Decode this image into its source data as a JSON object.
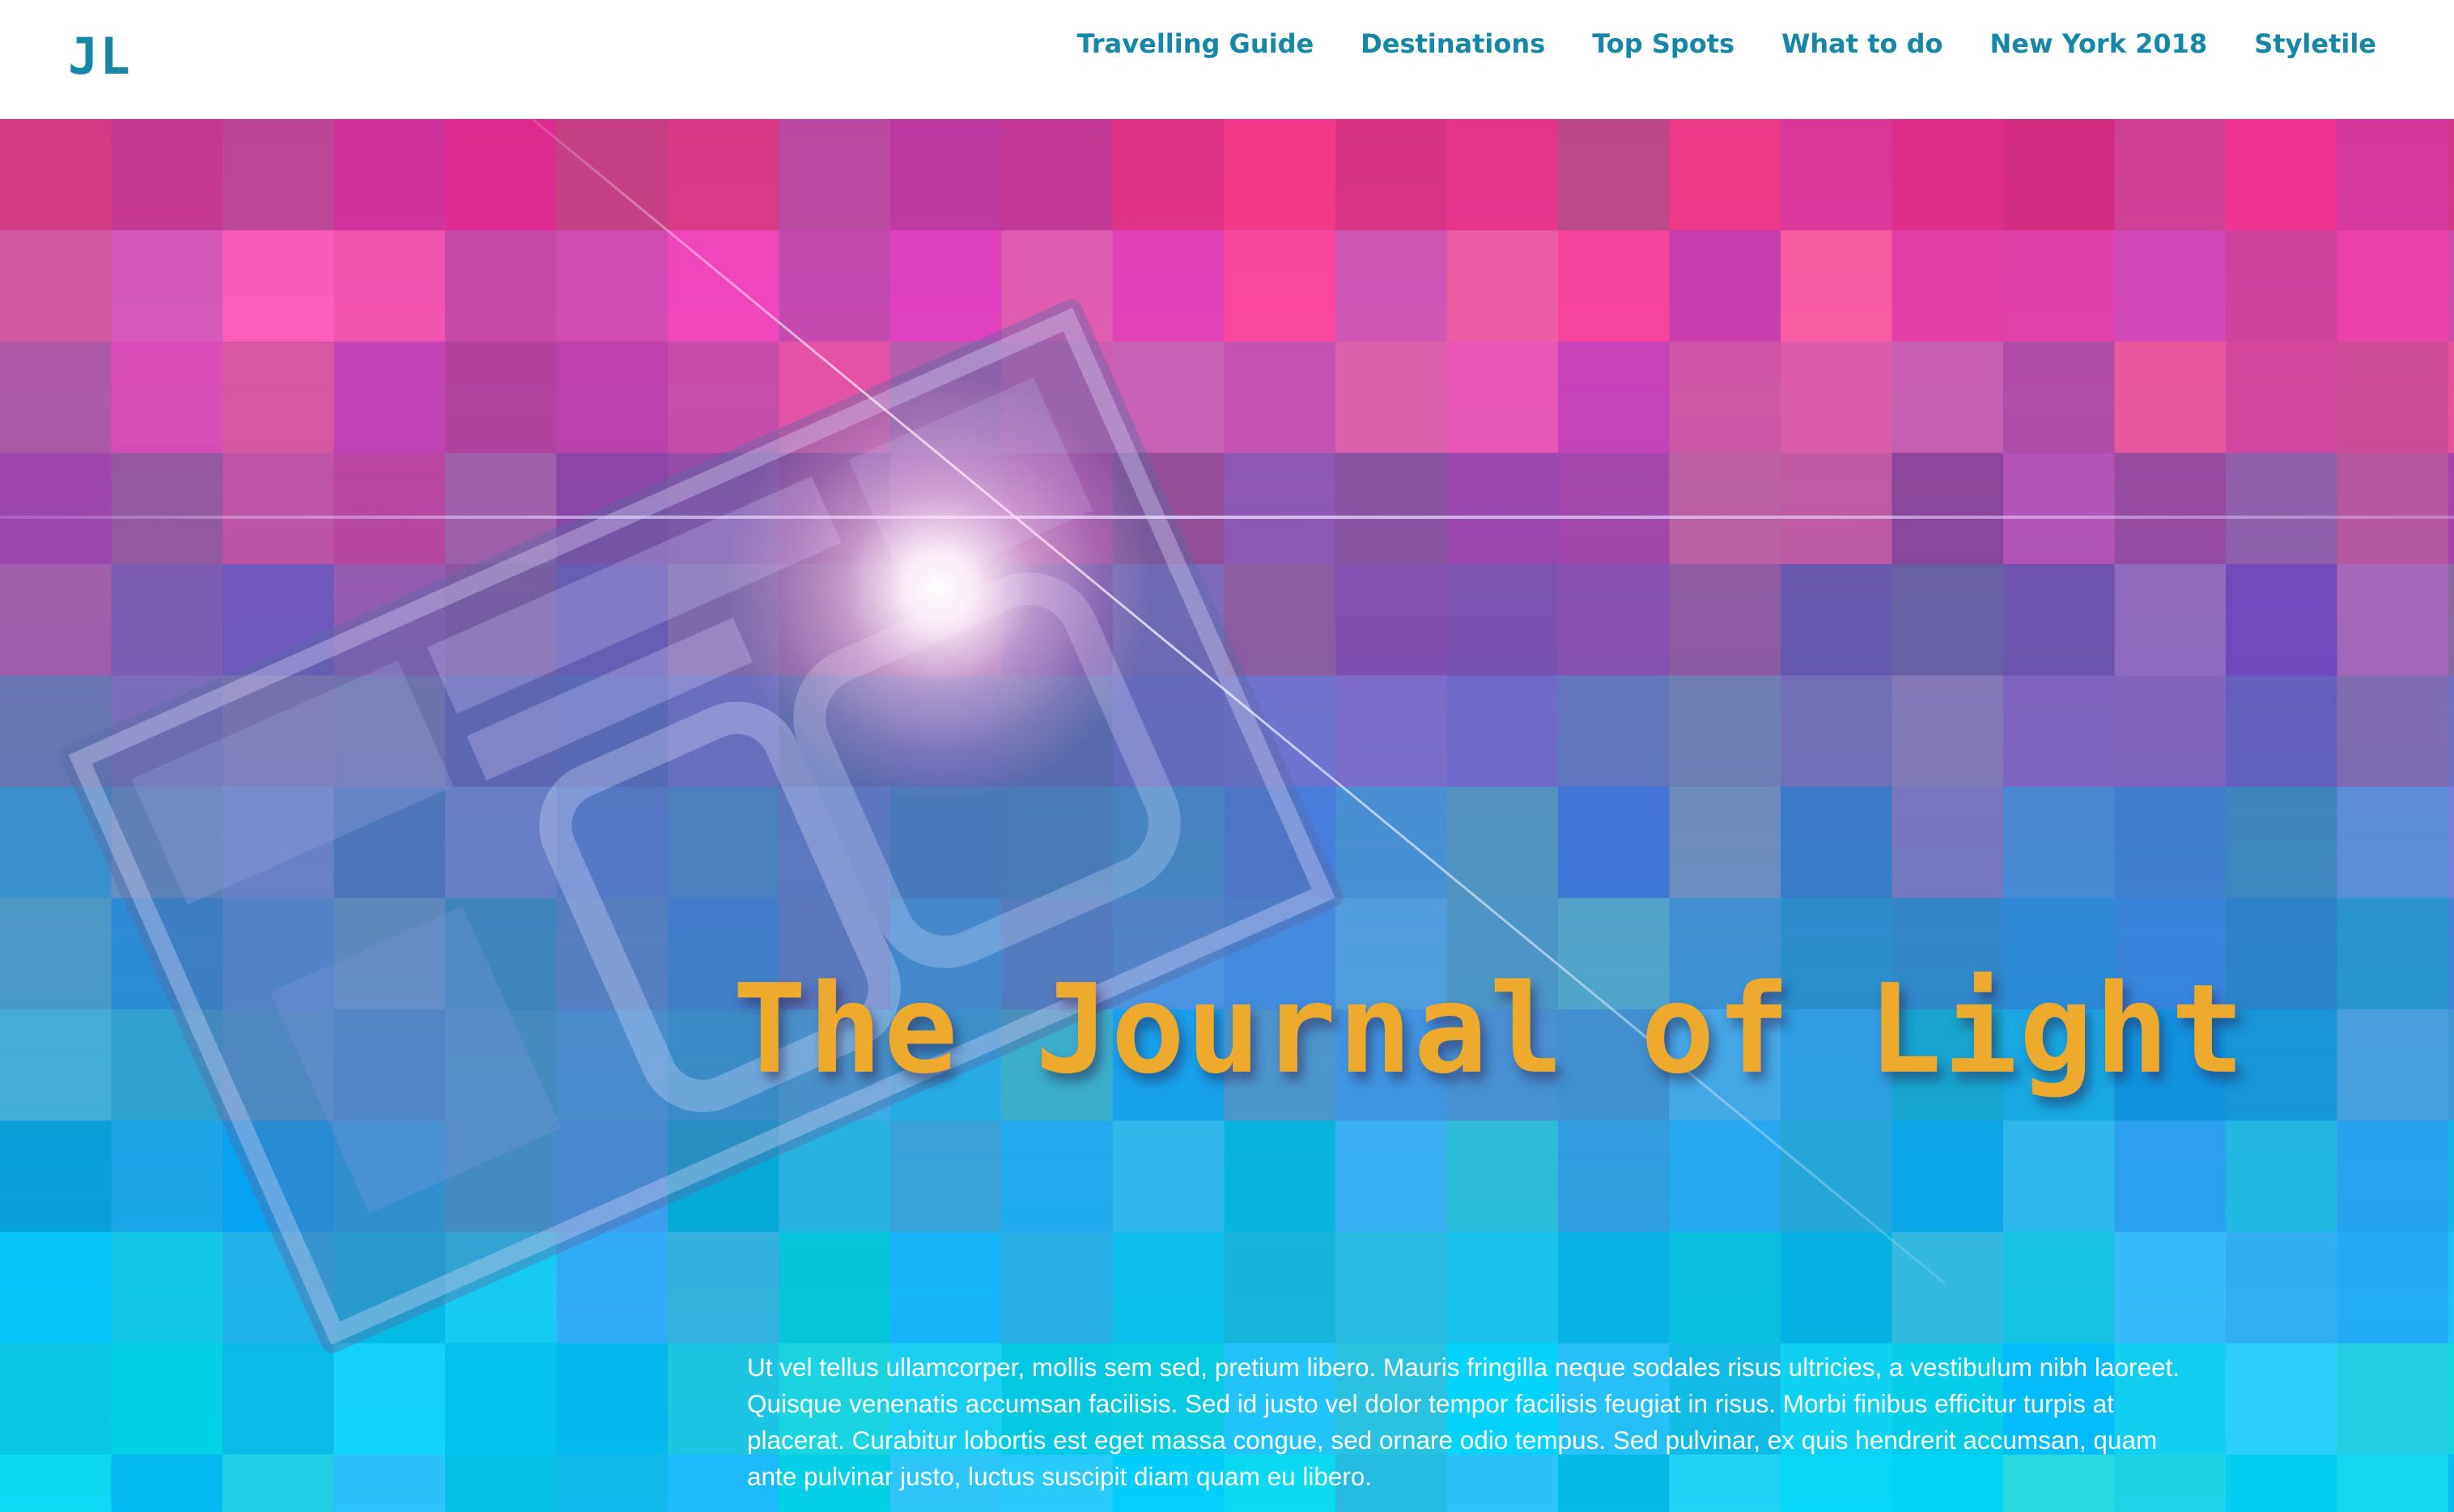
{
  "header": {
    "logo": "JL",
    "nav": [
      {
        "label": "Travelling Guide"
      },
      {
        "label": "Destinations"
      },
      {
        "label": "Top Spots"
      },
      {
        "label": "What to do"
      },
      {
        "label": "New York 2018"
      },
      {
        "label": "Styletile"
      }
    ]
  },
  "hero": {
    "title": "The Journal of Light",
    "body": "Ut vel tellus ullamcorper, mollis sem sed, pretium libero. Mauris fringilla neque sodales risus ultricies, a vestibulum nibh laoreet. Quisque venenatis accumsan facilisis. Sed id justo vel dolor tempor facilisis feugiat in risus. Morbi finibus efficitur turpis at placerat. Curabitur lobortis est eget massa congue, sed ornare odio tempus. Sed pulvinar, ex quis hendrerit accumsan, quam ante pulvinar justo, luctus suscipit diam quam eu libero."
  },
  "colors": {
    "brand": "#1787a8",
    "title": "#eeaa2d",
    "hero_top": "#cf3a8e",
    "hero_bottom": "#14b8e6"
  }
}
